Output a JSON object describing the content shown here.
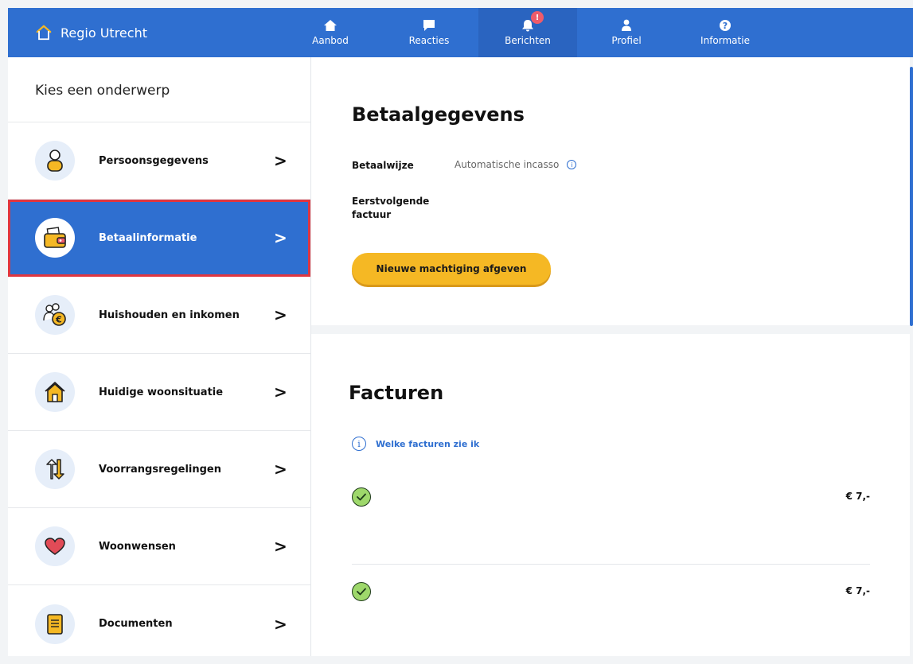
{
  "header": {
    "brand": "Regio Utrecht",
    "nav": [
      {
        "label": "Aanbod",
        "icon": "home-icon"
      },
      {
        "label": "Reacties",
        "icon": "chat-icon"
      },
      {
        "label": "Berichten",
        "icon": "bell-icon",
        "badge": "!"
      },
      {
        "label": "Profiel",
        "icon": "user-icon"
      },
      {
        "label": "Informatie",
        "icon": "question-icon"
      }
    ]
  },
  "sidebar": {
    "heading": "Kies een onderwerp",
    "items": [
      {
        "label": "Persoonsgegevens",
        "icon": "person-icon"
      },
      {
        "label": "Betaalinformatie",
        "icon": "wallet-icon",
        "active": true
      },
      {
        "label": "Huishouden en inkomen",
        "icon": "household-income-icon"
      },
      {
        "label": "Huidige woonsituatie",
        "icon": "house-icon"
      },
      {
        "label": "Voorrangsregelingen",
        "icon": "priority-arrows-icon"
      },
      {
        "label": "Woonwensen",
        "icon": "heart-icon"
      },
      {
        "label": "Documenten",
        "icon": "document-icon"
      }
    ],
    "chevron": ">"
  },
  "payment": {
    "title": "Betaalgegevens",
    "method_label": "Betaalwijze",
    "method_value": "Automatische incasso",
    "next_invoice_label_1": "Eerstvolgende",
    "next_invoice_label_2": "factuur",
    "button": "Nieuwe machtiging afgeven"
  },
  "invoices": {
    "title": "Facturen",
    "info_link": "Welke facturen zie ik",
    "items": [
      {
        "amount": "€ 7,-",
        "status": "paid"
      },
      {
        "amount": "€ 7,-",
        "status": "paid"
      }
    ]
  },
  "colors": {
    "primary": "#2f6fd0",
    "accent": "#f5b824",
    "highlight": "#e0363f",
    "success": "#9ed86b"
  }
}
